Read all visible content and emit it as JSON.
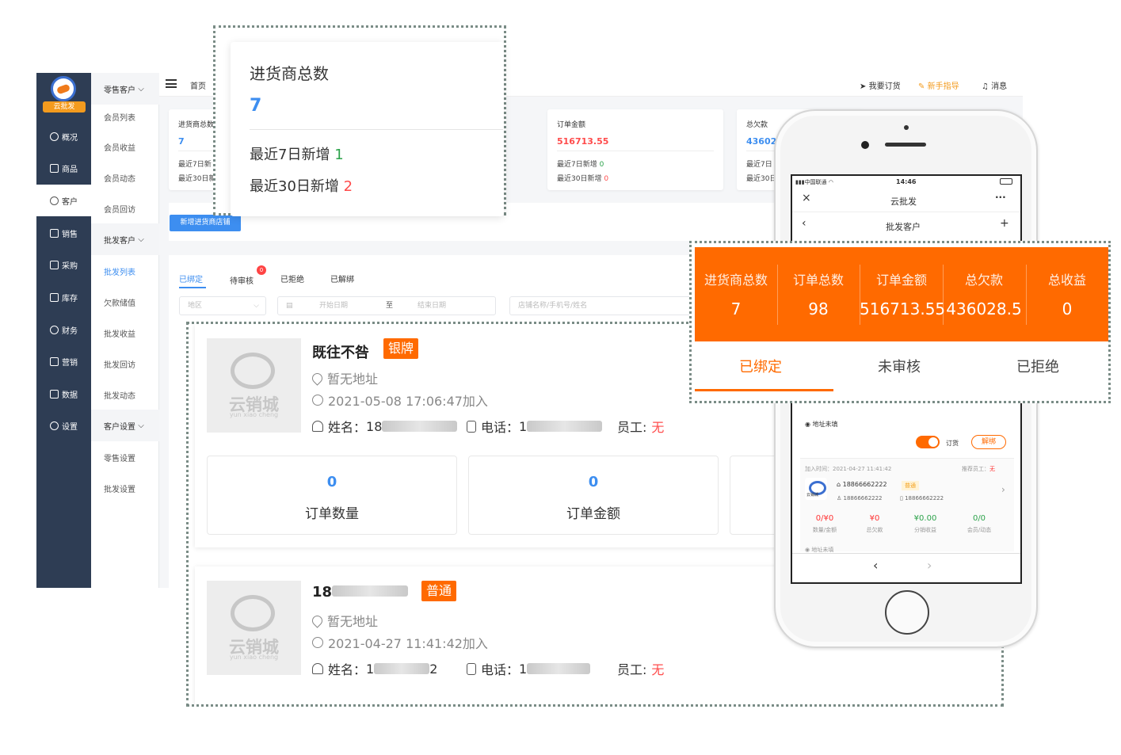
{
  "app": {
    "logo_badge": "云批发",
    "main_nav": [
      {
        "label": "概况",
        "icon": "dashboard-icon"
      },
      {
        "label": "商品",
        "icon": "grid-icon"
      },
      {
        "label": "客户",
        "icon": "user-icon"
      },
      {
        "label": "销售",
        "icon": "document-icon"
      },
      {
        "label": "采购",
        "icon": "cart-icon"
      },
      {
        "label": "库存",
        "icon": "stock-icon"
      },
      {
        "label": "财务",
        "icon": "finance-icon"
      },
      {
        "label": "营销",
        "icon": "marketing-icon"
      },
      {
        "label": "数据",
        "icon": "chart-icon"
      },
      {
        "label": "设置",
        "icon": "settings-icon"
      }
    ],
    "sub_nav": {
      "group1": "零售客户",
      "group1_items": [
        "会员列表",
        "会员收益",
        "会员动态",
        "会员回访"
      ],
      "group2": "批发客户",
      "group2_items": [
        "批发列表",
        "欠款储值",
        "批发收益",
        "批发回访",
        "批发动态"
      ],
      "group3": "客户设置",
      "group3_items": [
        "零售设置",
        "批发设置"
      ]
    },
    "topbar": {
      "home": "首页",
      "order": "我要订货",
      "guide": "新手指导",
      "message": "消息"
    },
    "stats": {
      "card1": {
        "title": "进货商总数",
        "value": "7",
        "d1": "最近7日新",
        "d2": "最近30日新"
      },
      "card2": {
        "title": "订单金额",
        "value": "516713.55",
        "d1": "最近7日新增",
        "d1v": "0",
        "d2": "最近30日新增",
        "d2v": "0"
      },
      "card3": {
        "title": "总欠款",
        "value": "43602",
        "d1": "最近7日",
        "d2": "最近30日"
      }
    },
    "add_button": "新增进货商店铺",
    "tabs": [
      {
        "label": "已绑定"
      },
      {
        "label": "待审核",
        "badge": "0"
      },
      {
        "label": "已拒绝"
      },
      {
        "label": "已解绑"
      }
    ],
    "filters": {
      "region": "地区",
      "start_date": "开始日期",
      "to": "至",
      "end_date": "结束日期",
      "search": "店铺名称/手机号/姓名"
    }
  },
  "zoom_total": {
    "title": "进货商总数",
    "value": "7",
    "l1": "最近7日新增",
    "l1v": "1",
    "l2": "最近30日新增",
    "l2v": "2"
  },
  "customers": [
    {
      "name": "既往不咎",
      "level": "银牌",
      "address": "暂无地址",
      "joined": "2021-05-08 17:06:47加入",
      "name_label": "姓名：",
      "name_prefix": "18",
      "phone_label": "电话：",
      "phone_prefix": "1",
      "staff_label": "员工:",
      "staff_value": "无",
      "metrics": [
        {
          "value": "0",
          "label": "订单数量"
        },
        {
          "value": "0",
          "label": "订单金额"
        }
      ]
    },
    {
      "name": "18",
      "level": "普通",
      "address": "暂无地址",
      "joined": "2021-04-27 11:41:42加入",
      "name_label": "姓名：",
      "name_prefix": "1",
      "name_suffix": "2",
      "phone_label": "电话：",
      "phone_prefix": "1",
      "staff_label": "员工:",
      "staff_value": "无"
    }
  ],
  "logo_text": {
    "cn": "云销城",
    "en": "yun xiao cheng"
  },
  "phone": {
    "carrier": "中国联通",
    "time": "14:46",
    "app_title": "云批发",
    "page_title": "批发客户",
    "address_empty": "地址未填",
    "order_toggle": "订货",
    "unbind": "解绑",
    "join_time": "加入时间：2021-04-27 11:41:42",
    "referrer": "推荐员工：",
    "referrer_value": "无",
    "customer_phone": "18866662222",
    "customer_level": "普通",
    "contact1": "18866662222",
    "contact2": "18866662222",
    "mini_logo": "云销城",
    "stats": [
      {
        "value": "0/¥0",
        "label": "数量/金额"
      },
      {
        "value": "¥0",
        "label": "总欠款"
      },
      {
        "value": "¥0.00",
        "label": "分销收益"
      },
      {
        "value": "0/0",
        "label": "会员/动态"
      }
    ],
    "address_empty2": "地址未填"
  },
  "zoom_phone": {
    "cells": [
      {
        "label": "进货商总数",
        "value": "7"
      },
      {
        "label": "订单总数",
        "value": "98"
      },
      {
        "label": "订单金额",
        "value": "516713.55"
      },
      {
        "label": "总欠款",
        "value": "436028.5"
      },
      {
        "label": "总收益",
        "value": "0"
      }
    ],
    "tabs": [
      "已绑定",
      "未审核",
      "已拒绝"
    ]
  },
  "colors": {
    "accent_blue": "#3d8ef0",
    "accent_orange": "#ff6a00",
    "sidebar": "#2e3d54",
    "danger": "#ff4b4b"
  }
}
